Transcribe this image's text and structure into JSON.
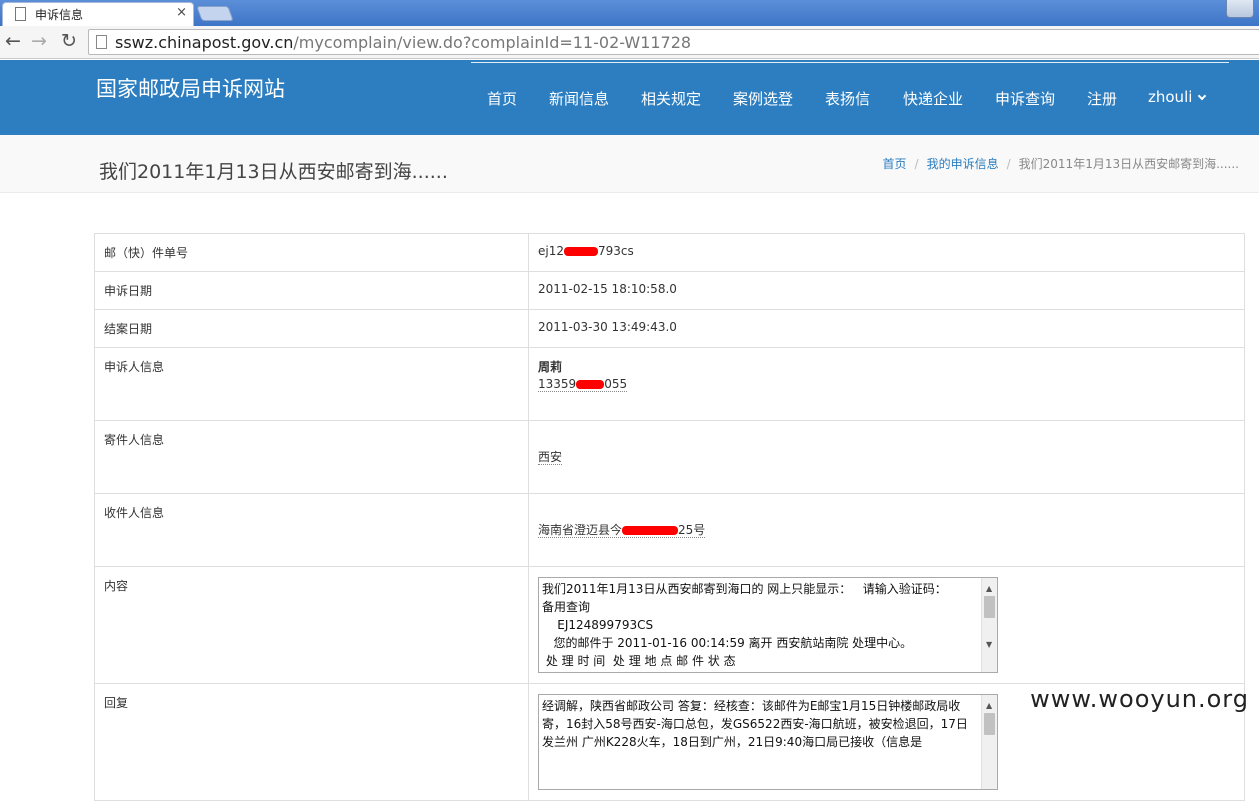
{
  "browser": {
    "tab_title": "申诉信息",
    "tab_close": "×",
    "url_host": "sswz.chinapost.gov.cn",
    "url_path": "/mycomplain/view.do?complainId=11-02-W11728"
  },
  "site": {
    "title": "国家邮政局申诉网站",
    "nav": [
      "首页",
      "新闻信息",
      "相关规定",
      "案例选登",
      "表扬信",
      "快递企业",
      "申诉查询",
      "注册"
    ],
    "user": "zhouli"
  },
  "page": {
    "title": "我们2011年1月13日从西安邮寄到海......",
    "breadcrumb": [
      "首页",
      "我的申诉信息",
      "我们2011年1月13日从西安邮寄到海......"
    ]
  },
  "details": {
    "tracking_label": "邮（快）件单号",
    "tracking_pre": "ej12",
    "tracking_post": "793cs",
    "complaint_date_label": "申诉日期",
    "complaint_date": "2011-02-15 18:10:58.0",
    "closed_date_label": "结案日期",
    "closed_date": "2011-03-30 13:49:43.0",
    "complainant_label": "申诉人信息",
    "complainant_name": "周莉",
    "complainant_phone_pre": "13359",
    "complainant_phone_post": "055",
    "sender_label": "寄件人信息",
    "sender": "西安",
    "recipient_label": "收件人信息",
    "recipient_pre": "海南省澄迈县今",
    "recipient_post": "25号",
    "content_label": "内容",
    "content_text": "我们2011年1月13日从西安邮寄到海口的 网上只能显示：   请输入验证码：\n备用查询\n    EJ124899793CS\n   您的邮件于 2011-01-16 00:14:59 离开 西安航站南院 处理中心。\n 处 理 时 间  处 理 地 点 邮 件 状 态",
    "reply_label": "回复",
    "reply_text": "经调解，陕西省邮政公司 答复：经核查：该邮件为E邮宝1月15日钟楼邮政局收寄，16封入58号西安-海口总包，发GS6522西安-海口航班，被安检退回，17日发兰州 广州K228火车，18日到广州，21日9:40海口局已接收（信息是"
  },
  "watermark": "www.wooyun.org"
}
